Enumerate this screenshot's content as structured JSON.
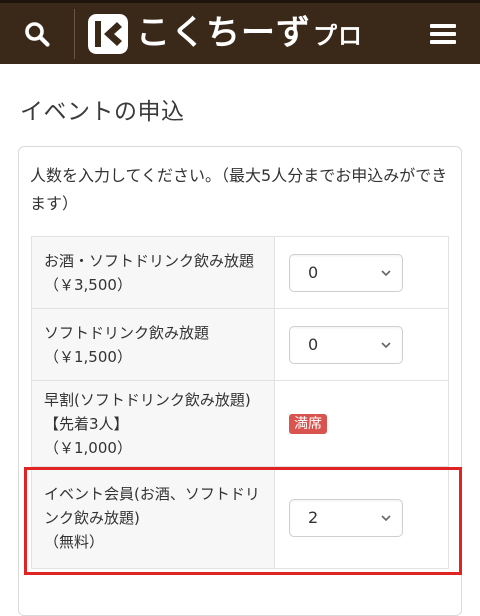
{
  "header": {
    "logo_main": "こくちーず",
    "logo_sub": "プロ",
    "icons": {
      "search": "search-icon",
      "menu": "hamburger-menu-icon",
      "logo_mark": "kokuchpro-logo-icon"
    },
    "colors": {
      "background": "#3a2818",
      "text": "#ffffff"
    }
  },
  "page": {
    "title": "イベントの申込"
  },
  "form": {
    "instruction": "人数を入力してください。（最大5人分までお申込みができます）",
    "tickets": [
      {
        "name": "お酒・ソフトドリンク飲み放題",
        "price": "（￥3,500）",
        "selected": "0"
      },
      {
        "name": "ソフトドリンク飲み放題",
        "price": "（￥1,500）",
        "selected": "0"
      },
      {
        "name": "早割(ソフトドリンク飲み放題)",
        "note": "【先着3人】",
        "price": "（￥1,000）",
        "status": "満席"
      },
      {
        "name": "イベント会員(お酒、ソフトドリンク飲み放題)",
        "price": "（無料）",
        "selected": "2"
      }
    ],
    "colors": {
      "sold_out_badge": "#d9534f",
      "highlight_border": "#e02323"
    }
  }
}
